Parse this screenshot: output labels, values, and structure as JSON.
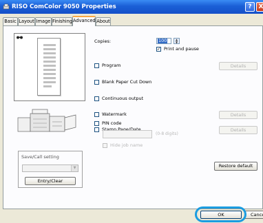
{
  "window": {
    "title": "RISO ComColor 9050 Properties",
    "help": "?",
    "close": "X"
  },
  "tabs": [
    {
      "label": "Basic"
    },
    {
      "label": "Layout"
    },
    {
      "label": "Image"
    },
    {
      "label": "Finishing"
    },
    {
      "label": "Advanced"
    },
    {
      "label": "About"
    }
  ],
  "copies": {
    "label": "Copies:",
    "value": "100",
    "print_and_pause": "Print and pause"
  },
  "options": {
    "program": "Program",
    "blank_paper_cut_down": "Blank Paper Cut Down",
    "continuous_output": "Continuous output",
    "watermark": "Watermark",
    "stamp_page_date": "Stamp Page/Date",
    "pin_code": "PIN code",
    "pin_hint": "(0-8 digits)",
    "hide_job_name": "Hide job name"
  },
  "buttons": {
    "details": "Details",
    "restore_default": "Restore default",
    "entry_clear": "Entry/Clear",
    "ok": "OK",
    "cancel": "Cancel"
  },
  "save_call": {
    "label": "Save/Call setting"
  },
  "colors": {
    "titlebar": "#1a5fd6",
    "highlight": "#1a9ce0"
  }
}
